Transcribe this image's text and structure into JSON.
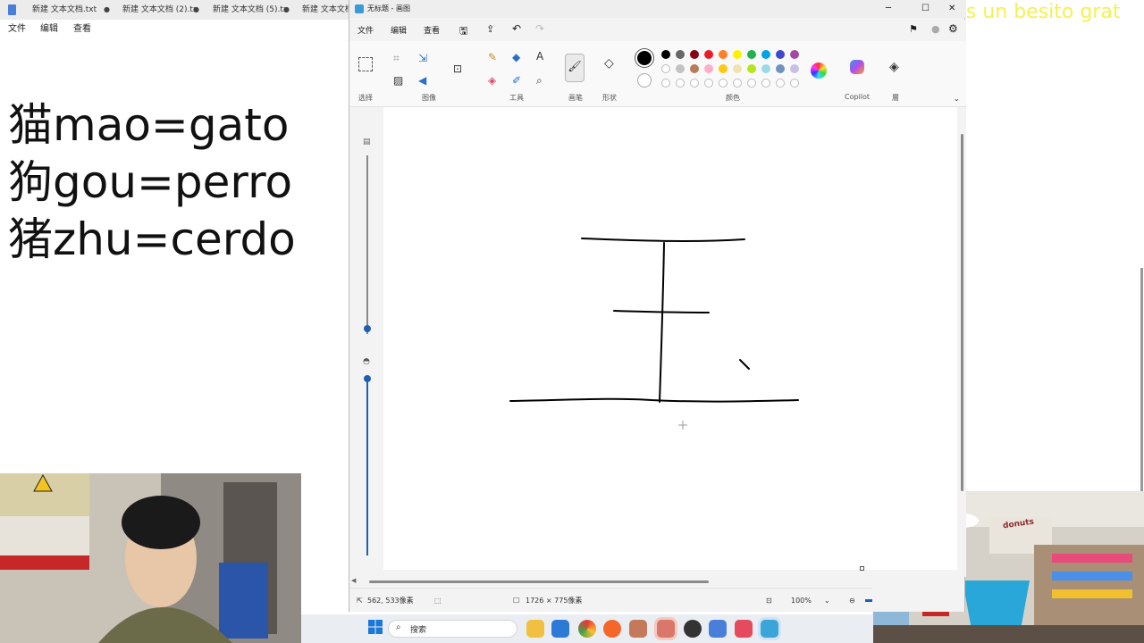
{
  "notepad": {
    "tabs": [
      "新建 文本文档.txt",
      "新建 文本文档 (2).tx",
      "新建 文本文档 (5).tx",
      "新建 文本文档"
    ],
    "menu": [
      "文件",
      "编辑",
      "查看"
    ],
    "lines": [
      "猫mao=gato",
      "狗gou=perro",
      "猪zhu=cerdo"
    ]
  },
  "paint": {
    "title": "无标题 - 画图",
    "menu": [
      "文件",
      "编辑",
      "查看"
    ],
    "groups": {
      "select": "选择",
      "image": "图像",
      "tools": "工具",
      "brush": "画笔",
      "shapes": "形状",
      "colors": "颜色",
      "copilot": "Copilot",
      "layers": "層"
    },
    "status": {
      "cursor": "562, 533像素",
      "size": "1726 × 775像素",
      "zoom": "100%"
    },
    "colors": {
      "row1": [
        "#000000",
        "#666666",
        "#880015",
        "#ed1c24",
        "#ff7f27",
        "#fff200",
        "#22b14c",
        "#00a2e8",
        "#3f48cc",
        "#a349a4"
      ],
      "row2": [
        "#ffffff",
        "#c3c3c3",
        "#b97a57",
        "#ffaec9",
        "#ffc90e",
        "#efe4b0",
        "#b5e61d",
        "#99d9ea",
        "#7092be",
        "#c8bfe7"
      ]
    }
  },
  "taskbar": {
    "search_placeholder": "搜索"
  },
  "overlay": {
    "text": "Cada subs tienes un besito grat"
  },
  "webcam_right": {
    "sign": "donuts"
  }
}
